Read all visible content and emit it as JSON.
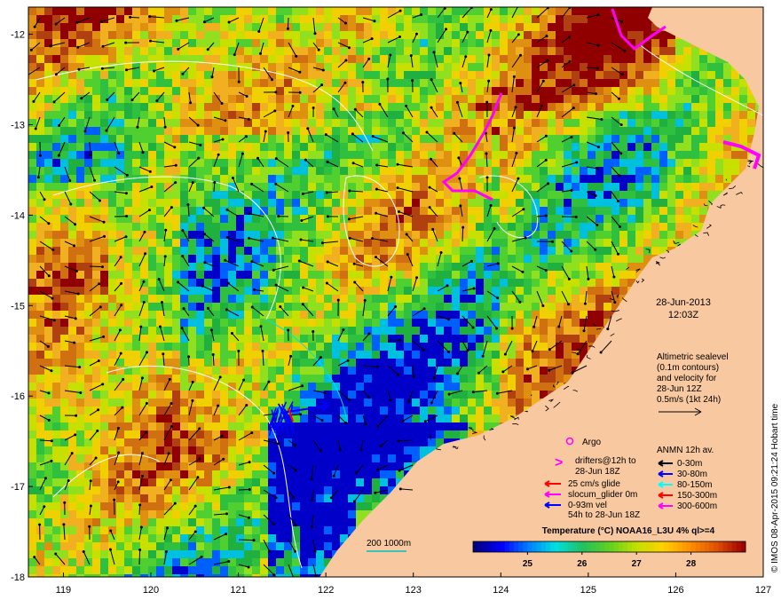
{
  "map": {
    "axes": {
      "lon_ticks": [
        "119",
        "120",
        "121",
        "122",
        "123",
        "124",
        "125",
        "126",
        "127"
      ],
      "lat_ticks": [
        "-12",
        "-13",
        "-14",
        "-15",
        "-16",
        "-17",
        "-18"
      ],
      "lon_range": [
        118.6,
        127
      ],
      "lat_range": [
        -18,
        -11.7
      ]
    },
    "date": "28-Jun-2013",
    "time": "12:03Z",
    "sealevel_note": [
      "Altimetric sealevel",
      "(0.1m contours)",
      "and velocity for",
      "28-Jun 12Z",
      "0.5m/s (1kt 24h)"
    ],
    "argo_label": "Argo",
    "drifters_label": [
      "drifters@12h to",
      "28-Jun 18Z"
    ],
    "glider_legend": [
      {
        "label": "25 cm/s glide",
        "color": "#ff0000"
      },
      {
        "label": "slocum_glider 0m",
        "color": "#ff00ff"
      },
      {
        "label": "0-93m vel",
        "color": "#0000ff"
      }
    ],
    "glider_sub": "54h to 28-Jun 18Z",
    "anmn_title": "ANMN 12h av.",
    "anmn_legend": [
      {
        "label": "0-30m",
        "color": "#000000"
      },
      {
        "label": "30-80m",
        "color": "#0000ff"
      },
      {
        "label": "80-150m",
        "color": "#00ffff"
      },
      {
        "label": "150-300m",
        "color": "#ff0000"
      },
      {
        "label": "300-600m",
        "color": "#ff00ff"
      }
    ],
    "colorbar_title": "Temperature (°C) NOAA16_L3U 4% ql>=4",
    "colorbar_ticks": [
      "25",
      "26",
      "27",
      "28"
    ],
    "colorbar_range": [
      24,
      29
    ],
    "colorbar_colors": [
      "#00007f",
      "#0000ff",
      "#0080ff",
      "#00e0e0",
      "#20c060",
      "#60d020",
      "#c0e000",
      "#ffd000",
      "#ff9000",
      "#e05000",
      "#a00000"
    ],
    "contour_label": "200  1000m",
    "side_credit": "© IMOS 08-Apr-2015 09:21:24 Hobart time",
    "colors": {
      "land": "#f8c8a0",
      "sst_palette": [
        "#0000c8",
        "#0060ff",
        "#00c0e0",
        "#20b040",
        "#30c040",
        "#50d030",
        "#90e020",
        "#c8e000",
        "#f0d000",
        "#f0b020",
        "#e09010",
        "#d07010",
        "#b04010",
        "#900000"
      ]
    },
    "markers": {
      "glider_shaft": "#0000ff",
      "argo": "#ff00ff",
      "drifter": "#ff00ff"
    }
  }
}
